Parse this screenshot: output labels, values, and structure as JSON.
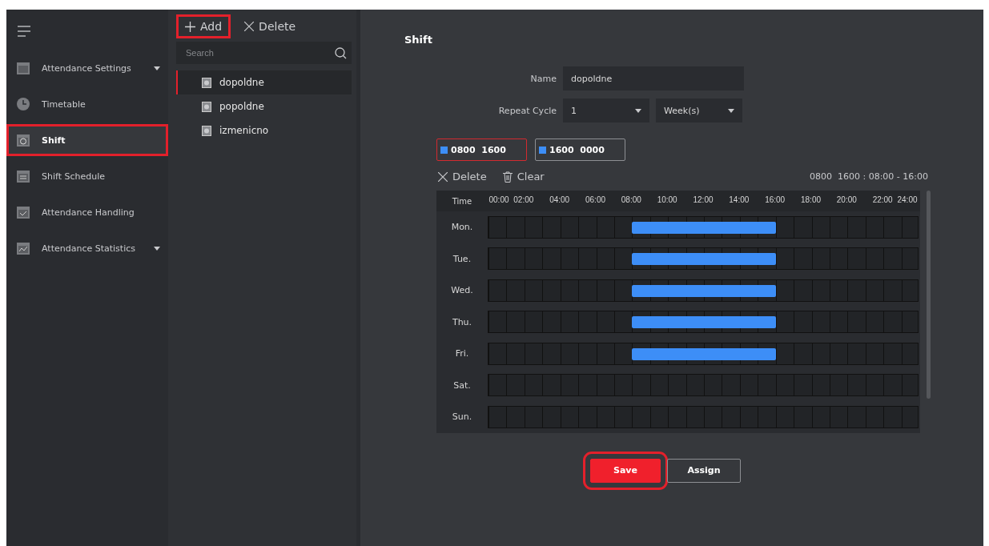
{
  "sidebar": {
    "items": [
      {
        "label": "Attendance Settings",
        "expandable": true,
        "selected": false,
        "highlighted": false
      },
      {
        "label": "Timetable",
        "expandable": false,
        "selected": false,
        "highlighted": false
      },
      {
        "label": "Shift",
        "expandable": false,
        "selected": true,
        "highlighted": true
      },
      {
        "label": "Shift Schedule",
        "expandable": false,
        "selected": false,
        "highlighted": false
      },
      {
        "label": "Attendance Handling",
        "expandable": false,
        "selected": false,
        "highlighted": false
      },
      {
        "label": "Attendance Statistics",
        "expandable": true,
        "selected": false,
        "highlighted": false
      }
    ]
  },
  "list_panel": {
    "toolbar": [
      {
        "kind": "add",
        "label": "Add",
        "highlighted": true
      },
      {
        "kind": "delete",
        "label": "Delete",
        "highlighted": false
      }
    ],
    "search": {
      "placeholder": "Search"
    },
    "items": [
      {
        "label": "dopoldne",
        "selected": true
      },
      {
        "label": "popoldne",
        "selected": false
      },
      {
        "label": "izmenicno",
        "selected": false
      }
    ]
  },
  "shift": {
    "title": "Shift",
    "name_label": "Name",
    "name_value": "dopoldne",
    "repeat_label": "Repeat Cycle",
    "repeat_value": "1",
    "repeat_unit": "Week(s)",
    "timetables": [
      {
        "label": "0800  1600",
        "color": "#3d8ef7",
        "selected": true
      },
      {
        "label": "1600  0000",
        "color": "#3d8ef7",
        "selected": false
      }
    ],
    "actions": [
      {
        "kind": "delete",
        "label": "Delete"
      },
      {
        "kind": "clear",
        "label": "Clear"
      }
    ],
    "summary": "0800  1600 : 08:00 - 16:00",
    "schedule": {
      "time_label": "Time",
      "ticks": [
        "00:00",
        "02:00",
        "04:00",
        "06:00",
        "08:00",
        "10:00",
        "12:00",
        "14:00",
        "16:00",
        "18:00",
        "20:00",
        "22:00",
        "24:00"
      ],
      "days": [
        {
          "label": "Mon.",
          "scheduled": true
        },
        {
          "label": "Tue.",
          "scheduled": true
        },
        {
          "label": "Wed.",
          "scheduled": true
        },
        {
          "label": "Thu.",
          "scheduled": true
        },
        {
          "label": "Fri.",
          "scheduled": true
        },
        {
          "label": "Sat.",
          "scheduled": false
        },
        {
          "label": "Sun.",
          "scheduled": false
        }
      ]
    },
    "buttons": [
      {
        "kind": "primary",
        "label": "Save",
        "highlighted": true
      },
      {
        "kind": "secondary",
        "label": "Assign",
        "highlighted": false
      }
    ]
  }
}
